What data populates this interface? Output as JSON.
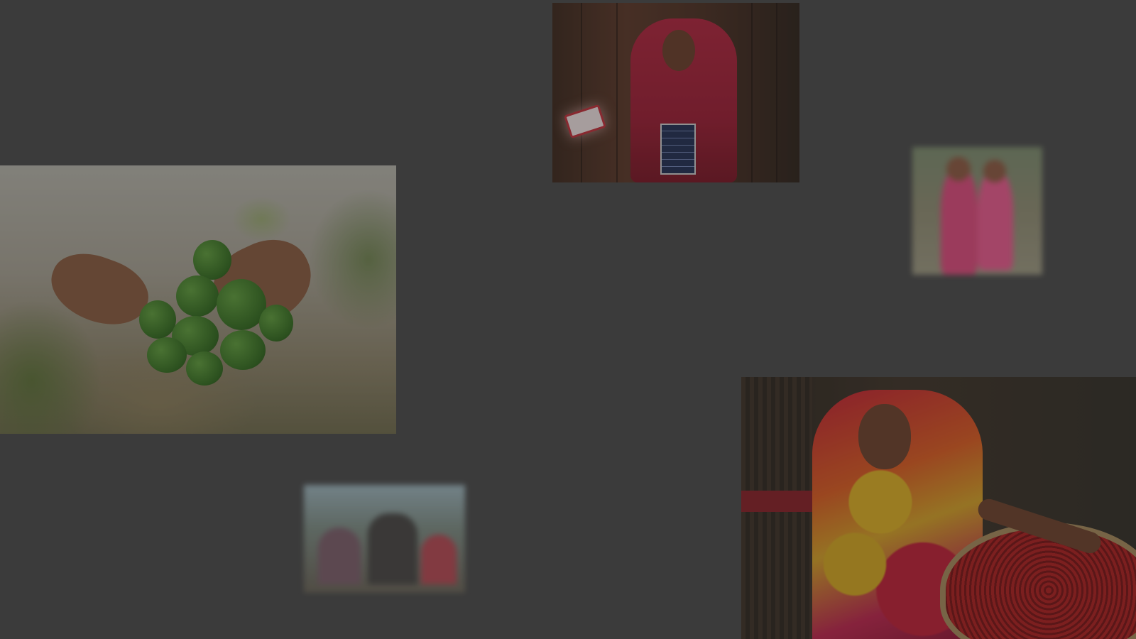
{
  "gallery": {
    "background_color": "#3b3b3b",
    "photos": [
      {
        "subject": "hands-holding-cucumbers",
        "state": "dimmed"
      },
      {
        "subject": "woman-holding-solar-panel-and-lamp",
        "state": "dimmed"
      },
      {
        "subject": "two-children",
        "state": "blurred"
      },
      {
        "subject": "street-scene",
        "state": "blurred"
      },
      {
        "subject": "woman-with-basket-of-red-chillies",
        "state": "dimmed"
      }
    ]
  }
}
